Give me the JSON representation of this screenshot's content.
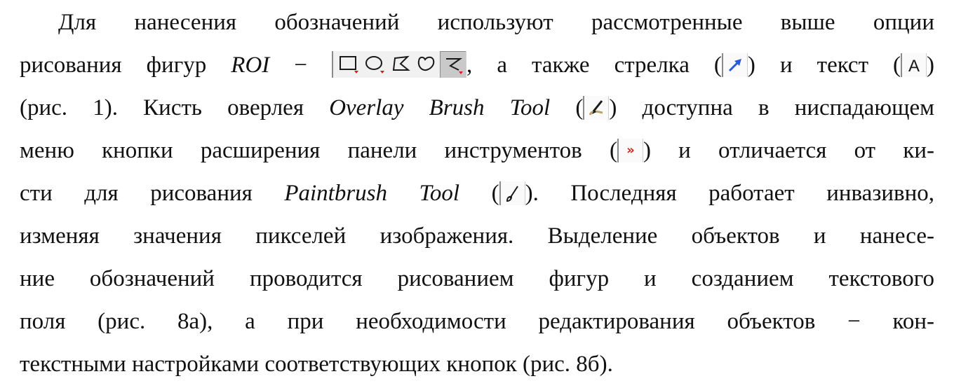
{
  "paragraph": {
    "l1": "Для нанесения обозначений используют рассмотренные выше опции",
    "l2a": "рисования фигур",
    "roi": "ROI",
    "dash1": "−",
    "l2b": ", а также стрелка (",
    "l2c": ") и текст (",
    "l2d": ")",
    "l3a": "(рис. 1). Кисть оверлея",
    "overlay_brush": "Overlay Brush Tool",
    "l3b": "(",
    "l3c": ") доступна в ниспадающем",
    "l4a": "меню кнопки расширения панели инструментов (",
    "l4b": ") и отличается от ки-",
    "l5a": "сти для рисования",
    "paintbrush": "Paintbrush Tool",
    "l5b": "(",
    "l5c": "). Последняя работает инвазивно,",
    "l6": "изменяя значения пикселей изображения. Выделение объектов и нанесе-",
    "l7": "ние обозначений проводится рисованием фигур и созданием текстового",
    "l8": "поля (рис. 8а), а при необходимости редактирования объектов − кон-",
    "l9": "текстными настройками соответствующих кнопок (рис. 8б)."
  },
  "icons": {
    "text_tool_glyph": "A",
    "more_tools_glyph": "»",
    "roi_toolbar": [
      "rectangle-icon",
      "oval-icon",
      "polygon-icon",
      "freehand-icon",
      "line-icon"
    ],
    "arrow": "arrow-icon",
    "text": "text-tool-icon",
    "overlay_brush": "overlay-brush-icon",
    "more_tools": "more-tools-icon",
    "paintbrush": "paintbrush-icon",
    "accent_red": "#d21f1f",
    "accent_blue": "#2a5bd7"
  }
}
